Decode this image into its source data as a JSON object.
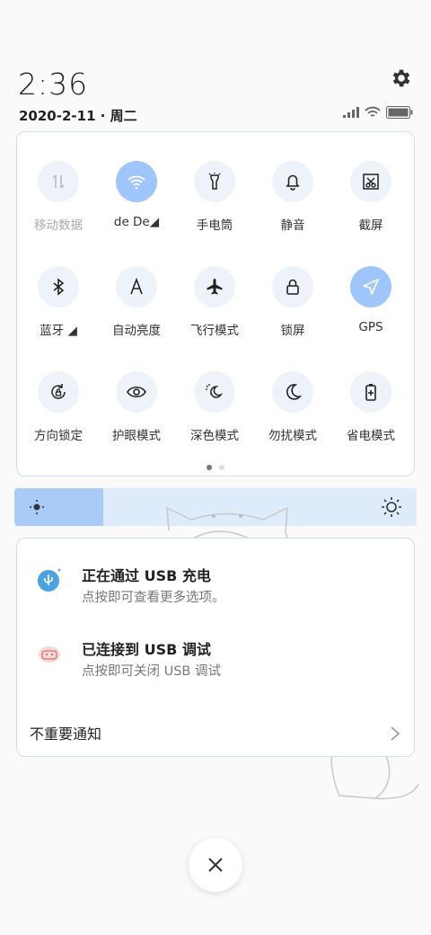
{
  "header": {
    "time": "2:36",
    "date": "2020-2-11 · 周二"
  },
  "tiles": [
    {
      "label": "移动数据",
      "icon": "mobile-data-icon",
      "active": false,
      "dim": true
    },
    {
      "label": "de   De◢",
      "icon": "wifi-icon",
      "active": true,
      "dim": false
    },
    {
      "label": "手电筒",
      "icon": "flashlight-icon",
      "active": false,
      "dim": false
    },
    {
      "label": "静音",
      "icon": "bell-icon",
      "active": false,
      "dim": false
    },
    {
      "label": "截屏",
      "icon": "screenshot-icon",
      "active": false,
      "dim": false
    },
    {
      "label": "蓝牙 ◢",
      "icon": "bluetooth-icon",
      "active": false,
      "dim": false
    },
    {
      "label": "自动亮度",
      "icon": "auto-brightness-icon",
      "active": false,
      "dim": false
    },
    {
      "label": "飞行模式",
      "icon": "airplane-icon",
      "active": false,
      "dim": false
    },
    {
      "label": "锁屏",
      "icon": "lock-icon",
      "active": false,
      "dim": false
    },
    {
      "label": "GPS",
      "icon": "gps-icon",
      "active": true,
      "dim": false
    },
    {
      "label": "方向锁定",
      "icon": "rotation-lock-icon",
      "active": false,
      "dim": false
    },
    {
      "label": "护眼模式",
      "icon": "eye-icon",
      "active": false,
      "dim": false
    },
    {
      "label": "深色模式",
      "icon": "dark-mode-icon",
      "active": false,
      "dim": false
    },
    {
      "label": "勿扰模式",
      "icon": "moon-icon",
      "active": false,
      "dim": false
    },
    {
      "label": "省电模式",
      "icon": "battery-saver-icon",
      "active": false,
      "dim": false
    }
  ],
  "pager": {
    "pages": 2,
    "current": 0
  },
  "brightness": {
    "level": 0.22
  },
  "notifications": [
    {
      "title": "正在通过 USB 充电",
      "text": "点按即可查看更多选项。",
      "icon": "usb-icon"
    },
    {
      "title": "已连接到 USB 调试",
      "text": "点按即可关闭 USB 调试",
      "icon": "android-debug-icon"
    }
  ],
  "footer": {
    "label": "不重要通知"
  },
  "colors": {
    "accent": "#9fc6fb",
    "tile_bg": "#eef3fa",
    "border": "#cfe0f5"
  }
}
